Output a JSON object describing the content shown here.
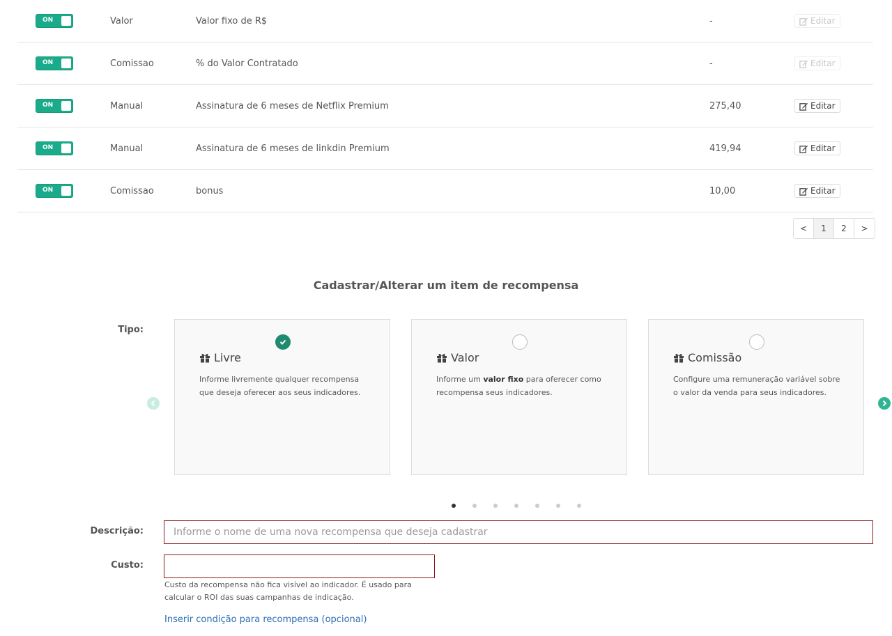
{
  "table": {
    "rows": [
      {
        "toggle": "ON",
        "type": "Valor",
        "description": "Valor fixo de R$",
        "value": "-",
        "action": "Editar",
        "action_disabled": true
      },
      {
        "toggle": "ON",
        "type": "Comissao",
        "description": "% do Valor Contratado",
        "value": "-",
        "action": "Editar",
        "action_disabled": true
      },
      {
        "toggle": "ON",
        "type": "Manual",
        "description": "Assinatura de 6 meses de Netflix Premium",
        "value": "275,40",
        "action": "Editar",
        "action_disabled": false
      },
      {
        "toggle": "ON",
        "type": "Manual",
        "description": "Assinatura de 6 meses de linkdin Premium",
        "value": "419,94",
        "action": "Editar",
        "action_disabled": false
      },
      {
        "toggle": "ON",
        "type": "Comissao",
        "description": "bonus",
        "value": "10,00",
        "action": "Editar",
        "action_disabled": false
      }
    ]
  },
  "pagination": {
    "prev": "<",
    "pages": [
      "1",
      "2"
    ],
    "current": "1",
    "next": ">"
  },
  "form": {
    "title": "Cadastrar/Alterar um item de recompensa",
    "tipo_label": "Tipo:",
    "cards": [
      {
        "title": "Livre",
        "text_before": "Informe livremente qualquer recompensa que deseja oferecer aos seus indicadores.",
        "bold": "",
        "text_after": "",
        "selected": true,
        "icon": "gift-icon"
      },
      {
        "title": "Valor",
        "text_before": "Informe um ",
        "bold": "valor fixo",
        "text_after": " para oferecer como recompensa seus indicadores.",
        "selected": false,
        "icon": "gift-icon"
      },
      {
        "title": "Comissão",
        "text_before": "Configure uma remuneração variável sobre o valor da venda para seus indicadores.",
        "bold": "",
        "text_after": "",
        "selected": false,
        "icon": "gift-icon"
      }
    ],
    "carousel_dots": 7,
    "carousel_active_dot": 1,
    "descricao_label": "Descrição:",
    "descricao_placeholder": "Informe o nome de uma nova recompensa que deseja cadastrar",
    "custo_label": "Custo:",
    "custo_value": "",
    "custo_help": "Custo da recompensa não fica visível ao indicador. É usado para calcular o ROI das suas campanhas de indicação.",
    "condition_link": "Inserir condição para recompensa (opcional)"
  },
  "colors": {
    "toggle_on": "#1aab8a",
    "check_selected": "#1e8a6e",
    "input_error_border": "#8b1a1a",
    "link": "#2a6db5",
    "arrow_active": "#2fb594",
    "arrow_inactive": "#c9ece1"
  }
}
